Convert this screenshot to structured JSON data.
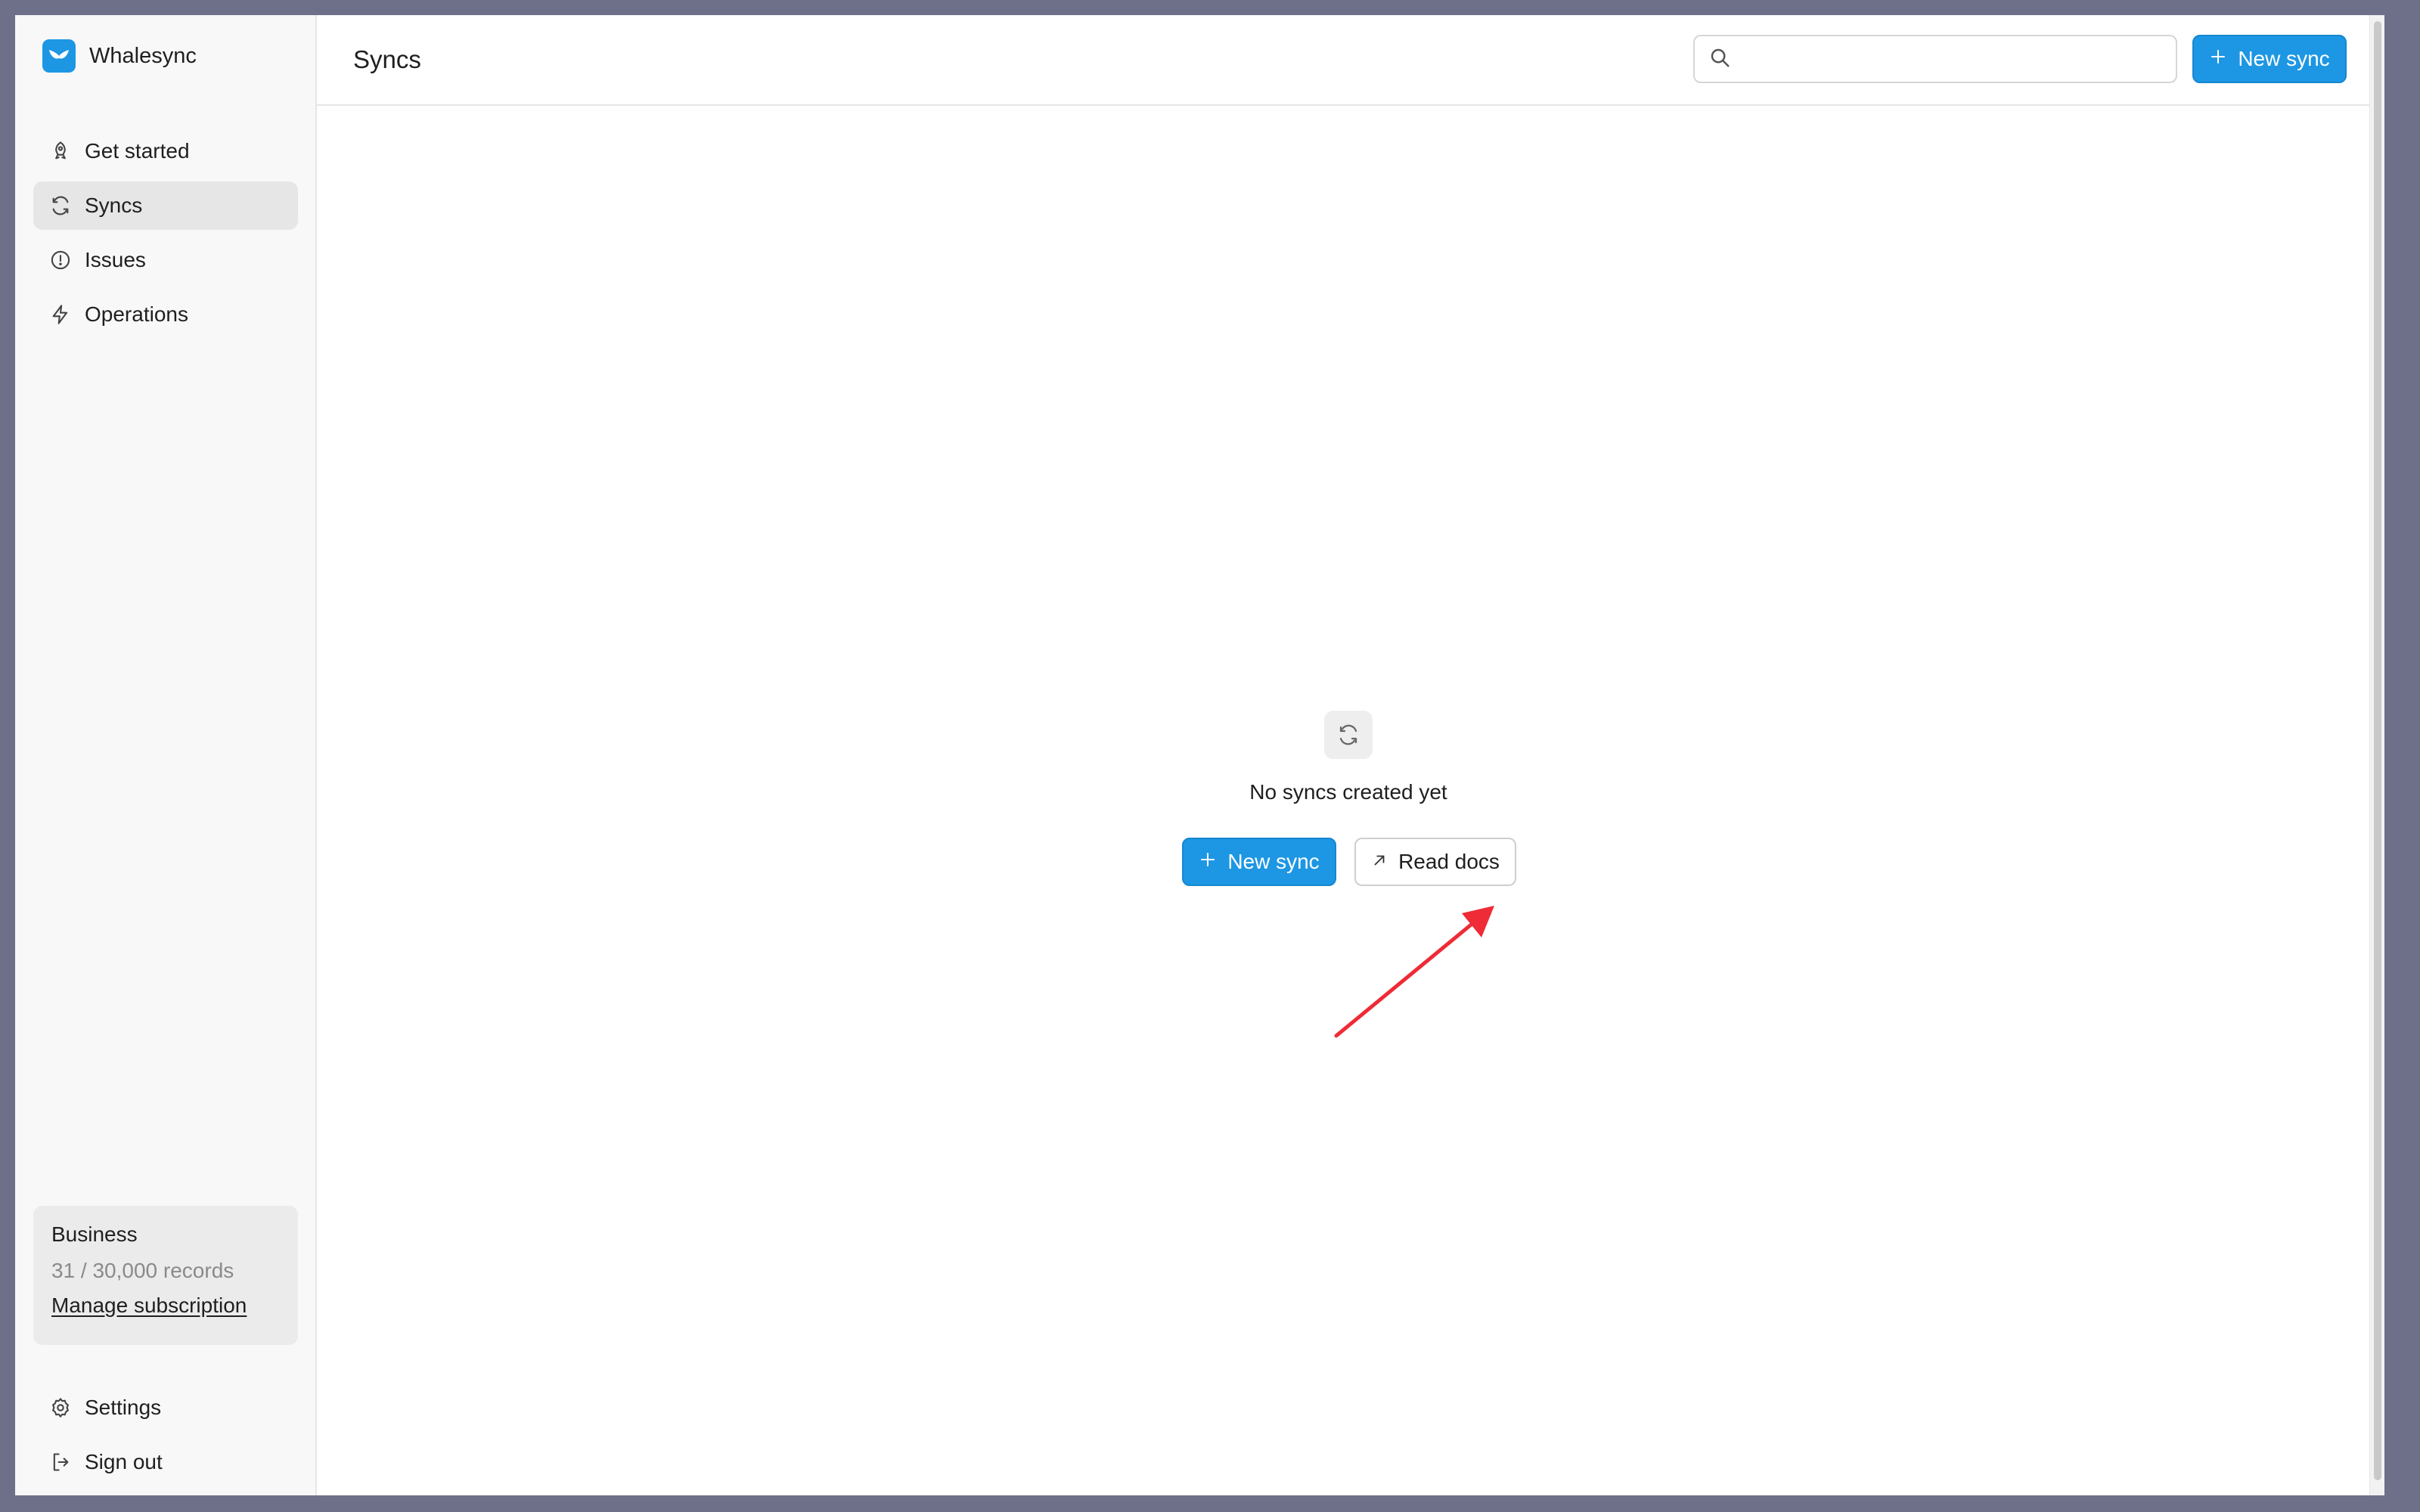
{
  "app": {
    "name": "Whalesync",
    "brand_color": "#1d97e4"
  },
  "sidebar": {
    "items": [
      {
        "label": "Get started",
        "icon": "rocket-icon"
      },
      {
        "label": "Syncs",
        "icon": "sync-icon",
        "active": true
      },
      {
        "label": "Issues",
        "icon": "alert-circle-icon"
      },
      {
        "label": "Operations",
        "icon": "lightning-icon"
      }
    ],
    "plan": {
      "name": "Business",
      "usage": "31 / 30,000 records",
      "manage_label": "Manage subscription"
    },
    "bottom_items": [
      {
        "label": "Settings",
        "icon": "gear-icon"
      },
      {
        "label": "Sign out",
        "icon": "sign-out-icon"
      }
    ]
  },
  "header": {
    "title": "Syncs",
    "search_placeholder": "",
    "new_sync_label": "New sync"
  },
  "empty_state": {
    "message": "No syncs created yet",
    "new_sync_label": "New sync",
    "read_docs_label": "Read docs"
  },
  "annotation": {
    "arrow_color": "#ee2b36"
  }
}
